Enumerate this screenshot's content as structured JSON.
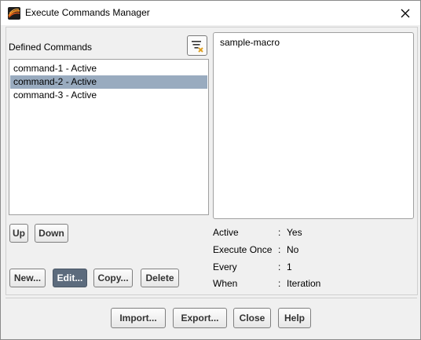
{
  "window": {
    "title": "Execute Commands Manager"
  },
  "commands": {
    "header": "Defined Commands",
    "items": [
      {
        "label": "command-1 - Active",
        "selected": false
      },
      {
        "label": "command-2 - Active",
        "selected": true
      },
      {
        "label": "command-3 - Active",
        "selected": false
      }
    ]
  },
  "preview": {
    "text": "sample-macro"
  },
  "list_buttons": {
    "up": "Up",
    "down": "Down"
  },
  "action_buttons": {
    "new": "New...",
    "edit": "Edit...",
    "copy": "Copy...",
    "delete": "Delete"
  },
  "properties": [
    {
      "label": "Active",
      "value": "Yes"
    },
    {
      "label": "Execute Once",
      "value": "No"
    },
    {
      "label": "Every",
      "value": "1"
    },
    {
      "label": "When",
      "value": "Iteration"
    }
  ],
  "separator": ":",
  "footer_buttons": {
    "import": "Import...",
    "export": "Export...",
    "close": "Close",
    "help": "Help"
  },
  "icons": {
    "app": "fluent-app-icon",
    "window_close": "close-icon",
    "filter": "filter-clear-icon"
  },
  "colors": {
    "selection": "#99abbf",
    "primary_button": "#5c6b7d"
  }
}
